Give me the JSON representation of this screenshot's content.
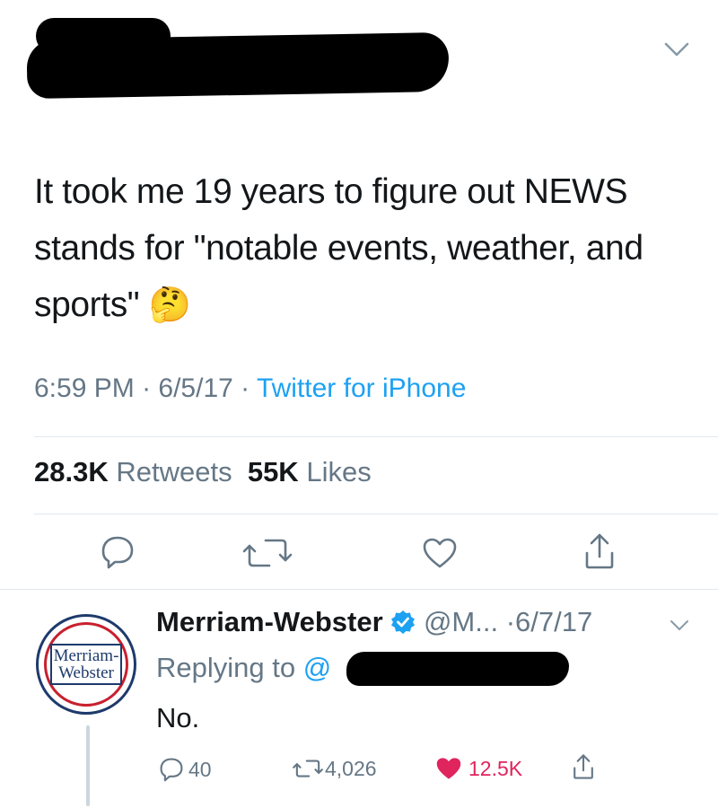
{
  "tweet": {
    "text": "It took me 19 years to figure out NEWS stands for \"notable events, weather, and sports\"",
    "emoji": "🤔",
    "time": "6:59 PM",
    "sep1": " · ",
    "date": "6/5/17",
    "sep2": " · ",
    "source": "Twitter for iPhone",
    "retweets_count": "28.3K",
    "retweets_label": "Retweets",
    "likes_count": "55K",
    "likes_label": "Likes"
  },
  "actions": [
    {
      "icon": "reply-icon"
    },
    {
      "icon": "retweet-icon"
    },
    {
      "icon": "like-icon"
    },
    {
      "icon": "share-icon"
    }
  ],
  "reply": {
    "avatar_text": "Merriam-\nWebster",
    "name": "Merriam-Webster",
    "handle": "@M...",
    "date_sep": " ·",
    "date": "6/7/17",
    "replying_prefix": "Replying to ",
    "replying_at": "@",
    "text": "No.",
    "reply_count": "40",
    "retweet_count": "4,026",
    "like_count": "12.5K"
  },
  "colors": {
    "link": "#1da1f2",
    "muted": "#657786",
    "like": "#e0245e",
    "verified": "#1da1f2",
    "brand_blue": "#1e3a6b",
    "brand_red": "#c8202f"
  }
}
